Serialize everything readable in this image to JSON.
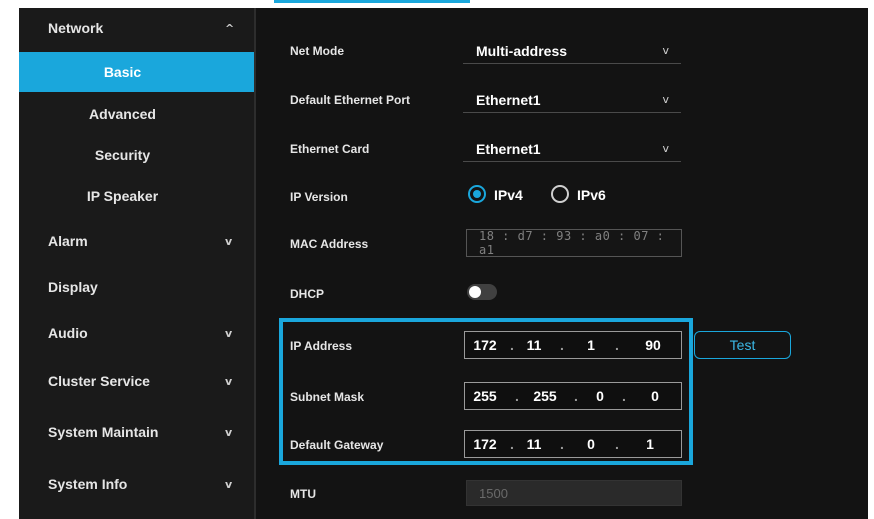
{
  "sidebar": {
    "items": [
      {
        "label": "Network",
        "chevron": "^"
      },
      {
        "label": "Basic"
      },
      {
        "label": "Advanced"
      },
      {
        "label": "Security"
      },
      {
        "label": "IP Speaker"
      },
      {
        "label": "Alarm",
        "chevron": "v"
      },
      {
        "label": "Display"
      },
      {
        "label": "Audio",
        "chevron": "v"
      },
      {
        "label": "Cluster Service",
        "chevron": "v"
      },
      {
        "label": "System Maintain",
        "chevron": "v"
      },
      {
        "label": "System Info",
        "chevron": "v"
      }
    ],
    "active_item": "Basic"
  },
  "form": {
    "net_mode": {
      "label": "Net Mode",
      "value": "Multi-address",
      "arrow": "v"
    },
    "default_port": {
      "label": "Default Ethernet Port",
      "value": "Ethernet1",
      "arrow": "v"
    },
    "ethernet_card": {
      "label": "Ethernet Card",
      "value": "Ethernet1",
      "arrow": "v"
    },
    "ip_version": {
      "label": "IP Version",
      "option_v4": "IPv4",
      "option_v6": "IPv6",
      "selected": "IPv4"
    },
    "mac": {
      "label": "MAC Address",
      "value": "18 : d7 : 93 : a0 : 07 : a1"
    },
    "dhcp": {
      "label": "DHCP",
      "enabled": false
    },
    "ip_address": {
      "label": "IP Address",
      "octets": [
        "172",
        "11",
        "1",
        "90"
      ],
      "test_label": "Test"
    },
    "subnet_mask": {
      "label": "Subnet Mask",
      "octets": [
        "255",
        "255",
        "0",
        "0"
      ]
    },
    "gateway": {
      "label": "Default Gateway",
      "octets": [
        "172",
        "11",
        "0",
        "1"
      ]
    },
    "mtu": {
      "label": "MTU",
      "value": "1500"
    }
  },
  "colors": {
    "accent": "#1aa7dc",
    "background": "#131313",
    "sidebar": "#1a1a1a"
  }
}
